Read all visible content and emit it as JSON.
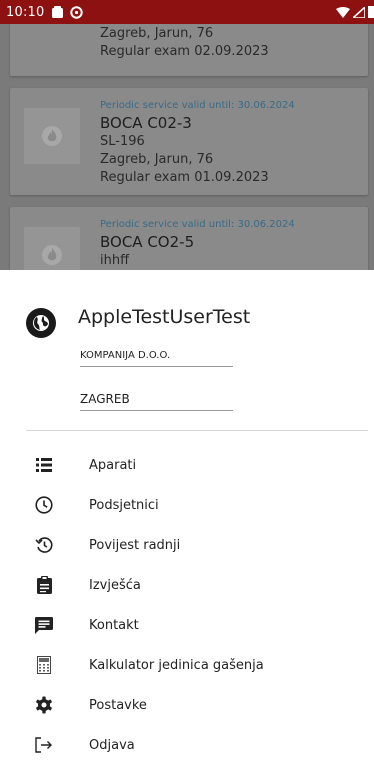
{
  "status_bar": {
    "time": "10:10"
  },
  "background_list": {
    "cards": [
      {
        "valid_until": "",
        "name": "",
        "code": "",
        "address": "Zagreb, Jarun, 76",
        "exam": "Regular exam 02.09.2023"
      },
      {
        "valid_until": "Periodic service valid until: 30.06.2024",
        "name": "BOCA C02-3",
        "code": "SL-196",
        "address": "Zagreb, Jarun, 76",
        "exam": "Regular exam 01.09.2023"
      },
      {
        "valid_until": "Periodic service valid until: 30.06.2024",
        "name": "BOCA CO2-5",
        "code": "ihhff",
        "address": "",
        "exam": ""
      }
    ]
  },
  "drawer": {
    "username": "AppleTestUserTest",
    "company": "KOMPANIJA D.O.O.",
    "city": "ZAGREB",
    "menu": [
      {
        "label": "Aparati",
        "icon": "list-icon"
      },
      {
        "label": "Podsjetnici",
        "icon": "clock-icon"
      },
      {
        "label": "Povijest radnji",
        "icon": "history-icon"
      },
      {
        "label": "Izvješća",
        "icon": "clipboard-icon"
      },
      {
        "label": "Kontakt",
        "icon": "chat-icon"
      },
      {
        "label": "Kalkulator jedinica gašenja",
        "icon": "calculator-icon"
      },
      {
        "label": "Postavke",
        "icon": "gear-icon"
      },
      {
        "label": "Odjava",
        "icon": "logout-icon"
      }
    ]
  }
}
